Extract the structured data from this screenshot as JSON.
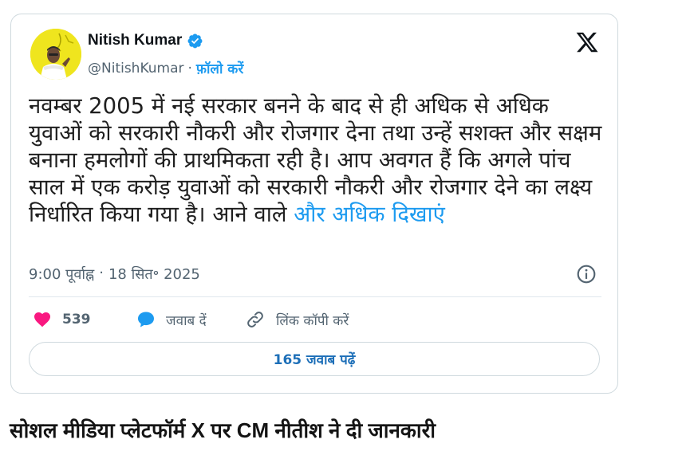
{
  "tweet": {
    "author_name": "Nitish Kumar",
    "handle": "@NitishKumar",
    "separator": "·",
    "follow_label": "फ़ॉलो करें",
    "text": "नवम्बर 2005 में नई सरकार बनने के बाद से ही अधिक से अधिक युवाओं को सरकारी नौकरी और रोजगार देना तथा उन्हें सशक्त और सक्षम बनाना हमलोगों की प्राथमिकता रही है। आप अवगत हैं कि अगले पांच साल में एक करोड़ युवाओं को सरकारी नौकरी और रोजगार देने का लक्ष्य निर्धारित किया गया है। आने वाले ",
    "show_more_label": "और अधिक दिखाएं",
    "time": "9:00 पूर्वाह्न",
    "meta_separator": "·",
    "date": "18 सित॰ 2025",
    "likes_count": "539",
    "reply_label": "जवाब दें",
    "copy_link_label": "लिंक कॉपी करें",
    "read_replies_label": "165 जवाब पढ़ें",
    "icons": {
      "verified": "verified-badge-icon",
      "logo": "x-logo-icon",
      "info": "info-icon",
      "like": "heart-icon",
      "reply": "speech-bubble-icon",
      "copy_link": "link-icon"
    },
    "colors": {
      "accent": "#1d9bf0",
      "like": "#f91880",
      "muted": "#536471",
      "avatar_bg": "#f0e620"
    }
  },
  "caption": {
    "text": "सोशल मीडिया प्लेटफॉर्म X पर CM नीतीश ने दी जानकारी"
  }
}
